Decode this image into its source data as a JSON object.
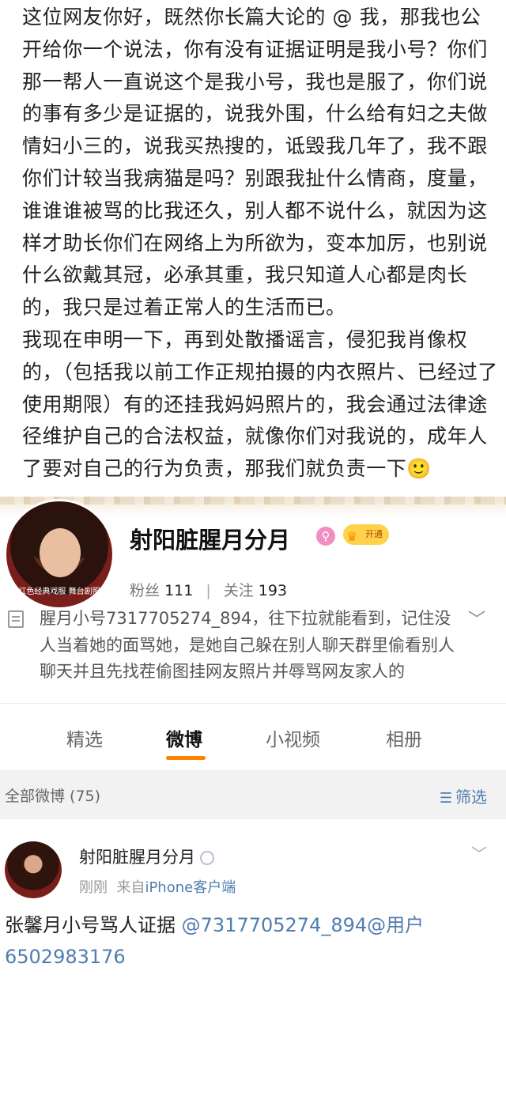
{
  "statement": {
    "para1": "这位网友你好，既然你长篇大论的 @ 我，那我也公开给你一个说法，你有没有证据证明是我小号？你们那一帮人一直说这个是我小号，我也是服了，你们说的事有多少是证据的，说我外围，什么给有妇之夫做情妇小三的，说我买热搜的，诋毁我几年了，我不跟你们计较当我病猫是吗？别跟我扯什么情商，度量，谁谁谁被骂的比我还久，别人都不说什么，就因为这样才助长你们在网络上为所欲为，变本加厉，也别说什么欲戴其冠，必承其重，我只知道人心都是肉长的，我只是过着正常人的生活而已。",
    "para2": "我现在申明一下，再到处散播谣言，侵犯我肖像权的，（包括我以前工作正规拍摄的内衣照片、已经过了使用期限）有的还挂我妈妈照片的，我会通过法律途径维护自己的合法权益，就像你们对我说的，成年人了要对自己的行为负责，那我们就负责一下",
    "emoji": "🙂"
  },
  "profile": {
    "name": "射阳脏腥月分月",
    "vip_label": "开通",
    "fans_label": "粉丝",
    "fans_count": "111",
    "follow_label": "关注",
    "follow_count": "193",
    "intro": "腥月小号7317705274_894，往下拉就能看到，记住没人当着她的面骂她，是她自己躲在别人聊天群里偷看别人聊天并且先找茬偷图挂网友照片并辱骂网友家人的",
    "avatar_caption": "红色经典戏服 舞台剧照"
  },
  "tabs": {
    "items": [
      "精选",
      "微博",
      "小视频",
      "相册"
    ],
    "active": "微博"
  },
  "filter": {
    "left": "全部微博 (75)",
    "right": "筛选"
  },
  "post": {
    "name": "射阳脏腥月分月",
    "time": "刚刚",
    "from_label": "来自",
    "source": "iPhone客户端",
    "text_prefix": "张馨月小号骂人证据 ",
    "mention": "@7317705274_894@用户6502983176"
  },
  "colors": {
    "accent": "#ff8200",
    "link": "#507daf",
    "filter_bg": "#f2f2f2"
  }
}
